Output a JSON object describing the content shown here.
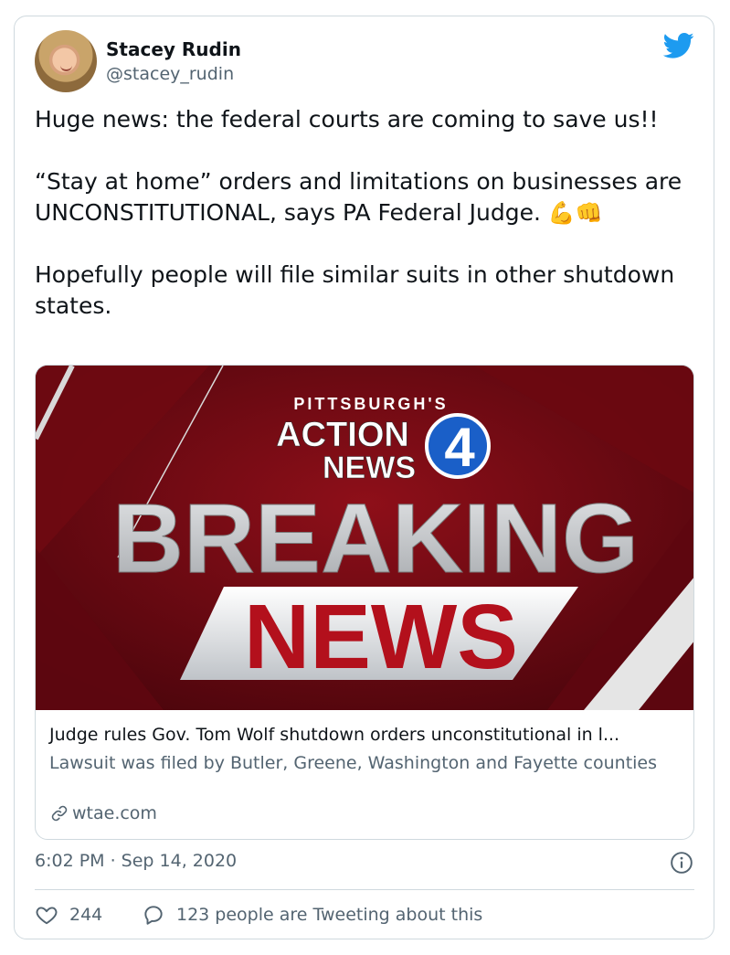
{
  "user": {
    "name": "Stacey Rudin",
    "handle": "@stacey_rudin"
  },
  "tweet": {
    "paragraphs": [
      "Huge news: the federal courts are coming to save us!!",
      "“Stay at home” orders and limitations on businesses are UNCONSTITUTIONAL, says PA Federal Judge.",
      "Hopefully people will file similar suits in other shutdown states."
    ],
    "emojis": "💪👊"
  },
  "card": {
    "image": {
      "station": "PITTSBURGH'S",
      "brand_line1": "ACTION",
      "brand_line2": "NEWS",
      "channel": "4",
      "headline1": "BREAKING",
      "headline2": "NEWS"
    },
    "title": "Judge rules Gov. Tom Wolf shutdown orders unconstitutional in l...",
    "description": "Lawsuit was filed by Butler, Greene, Washington and Fayette counties",
    "domain": "wtae.com"
  },
  "meta": {
    "timestamp": "6:02 PM · Sep 14, 2020"
  },
  "actions": {
    "likes": "244",
    "reply_text": "123 people are Tweeting about this"
  },
  "colors": {
    "twitter_blue": "#1d9bf0",
    "text_primary": "#0f1419",
    "text_secondary": "#536471",
    "border": "#cfd9de",
    "breaking_red": "#b3101c"
  },
  "icons": [
    "twitter-bird-icon",
    "link-icon",
    "info-icon",
    "heart-icon",
    "reply-bubble-icon"
  ]
}
